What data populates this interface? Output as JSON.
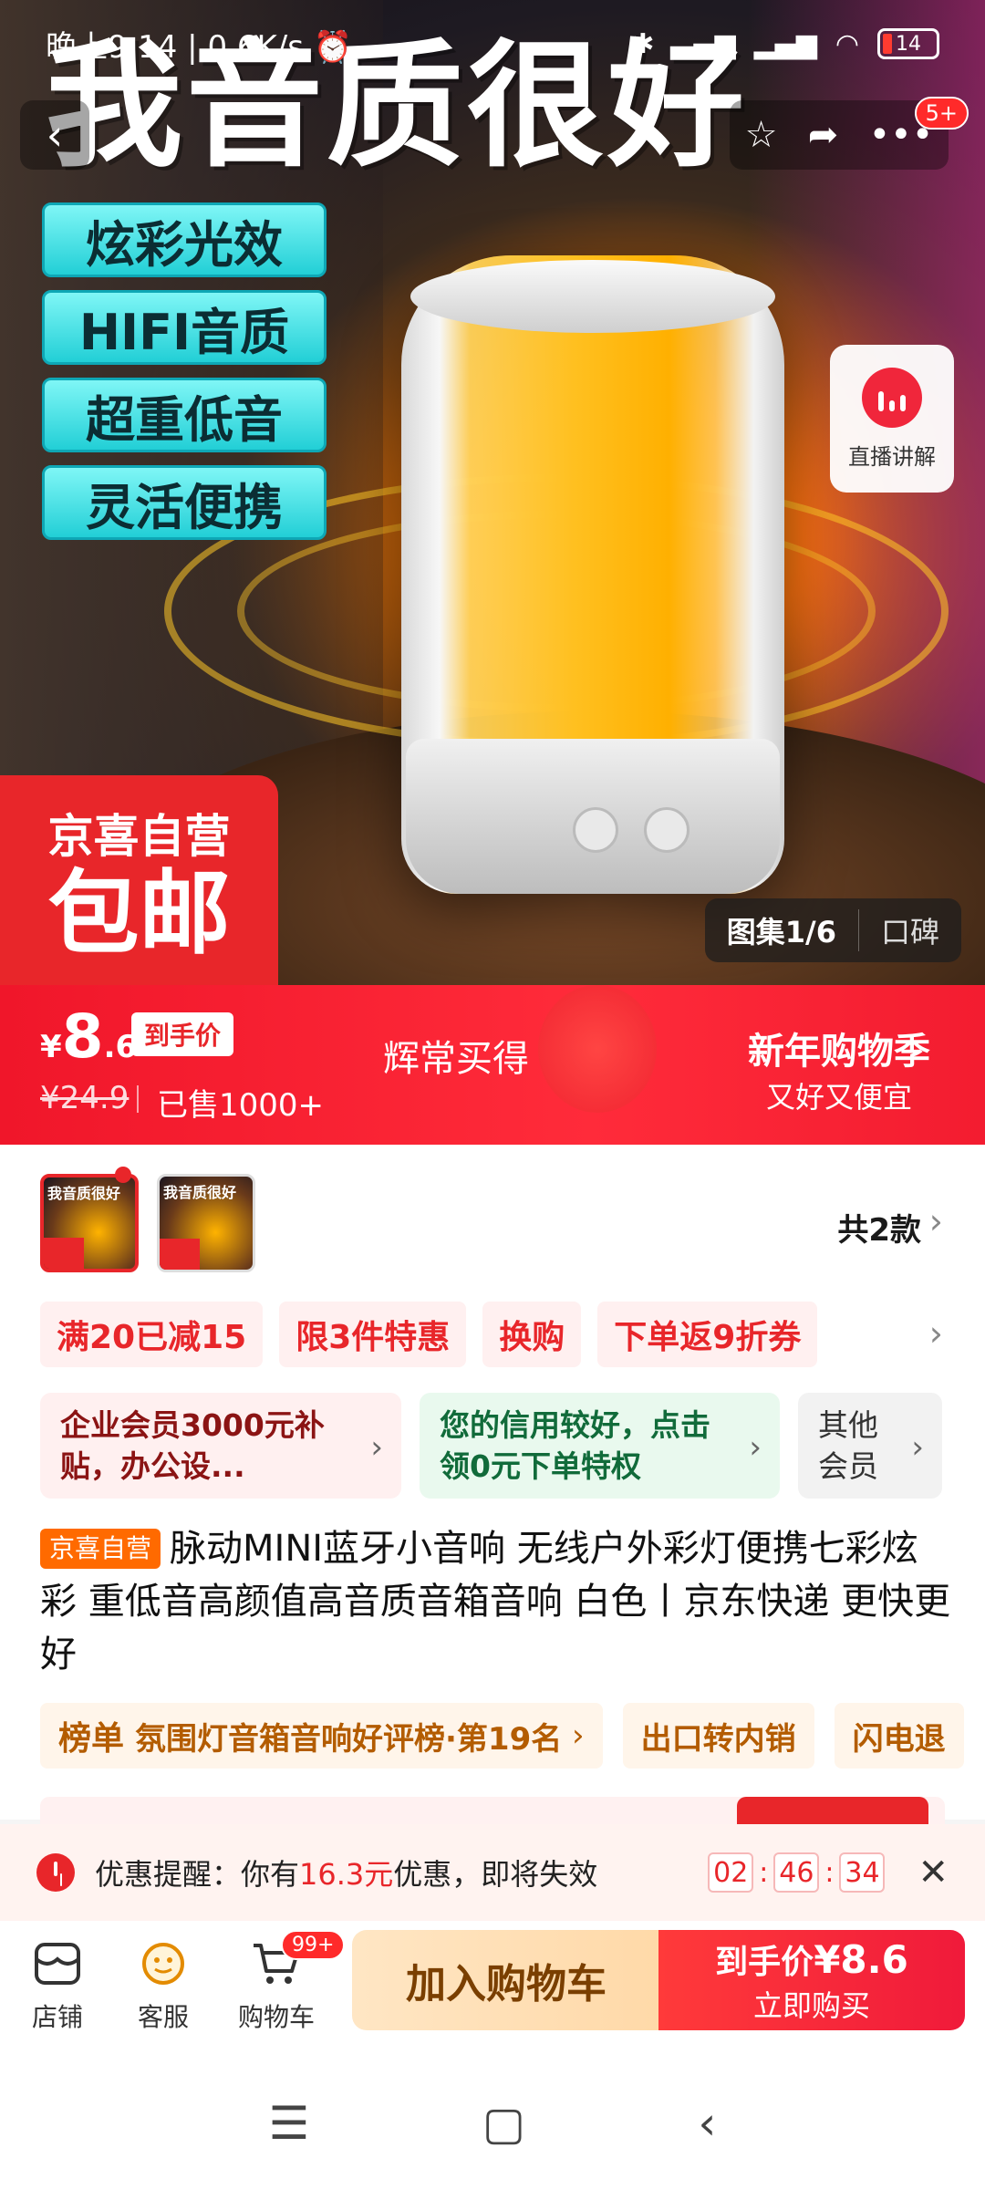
{
  "status_bar": {
    "time": "晚上9:14",
    "speed": "0.6K/s",
    "battery": "14"
  },
  "hero": {
    "title": "我音质很好",
    "features": [
      "炫彩光效",
      "HIFI音质",
      "超重低音",
      "灵活便携"
    ],
    "notif_badge": "5+",
    "live_label": "直播讲解",
    "promo_badge_line1": "京喜自营",
    "promo_badge_line2": "包邮",
    "gallery_label": "图集1/6",
    "reviews_label": "口碑"
  },
  "price_banner": {
    "currency": "¥",
    "price_int": "8",
    "price_dec": ".6",
    "price_tag": "到手价",
    "original_price": "¥24.9",
    "sold": "已售1000+",
    "slogan": "辉常买得",
    "campaign_title": "新年购物季",
    "campaign_sub": "又好又便宜"
  },
  "variants": {
    "thumb_text": "我音质很好",
    "count_label": "共2款"
  },
  "promos": [
    "满20已减15",
    "限3件特惠",
    "换购",
    "下单返9折券"
  ],
  "members": {
    "enterprise": "企业会员3000元补贴，办公设...",
    "credit": "您的信用较好，点击领0元下单特权",
    "other": "其他会员"
  },
  "product": {
    "store_badge": "京喜自营",
    "title": "脉动MINI蓝牙小音响 无线户外彩灯便携七彩炫彩 重低音高颜值高音质音箱音响 白色丨京东快递 更快更好"
  },
  "rankings": {
    "rank_key": "榜单",
    "rank_value": "氛围灯音箱音响好评榜·第19名",
    "tag2": "出口转内销",
    "tag3": "闪电退"
  },
  "reminder": {
    "prefix": "优惠提醒：你有",
    "amount": "16.3元",
    "suffix": "优惠，即将失效",
    "h": "02",
    "m": "46",
    "s": "34"
  },
  "action_bar": {
    "store": "店铺",
    "service": "客服",
    "cart": "购物车",
    "cart_badge": "99+",
    "add_to_cart": "加入购物车",
    "buy_line1": "到手价",
    "buy_price": "¥8.6",
    "buy_line2": "立即购买"
  }
}
